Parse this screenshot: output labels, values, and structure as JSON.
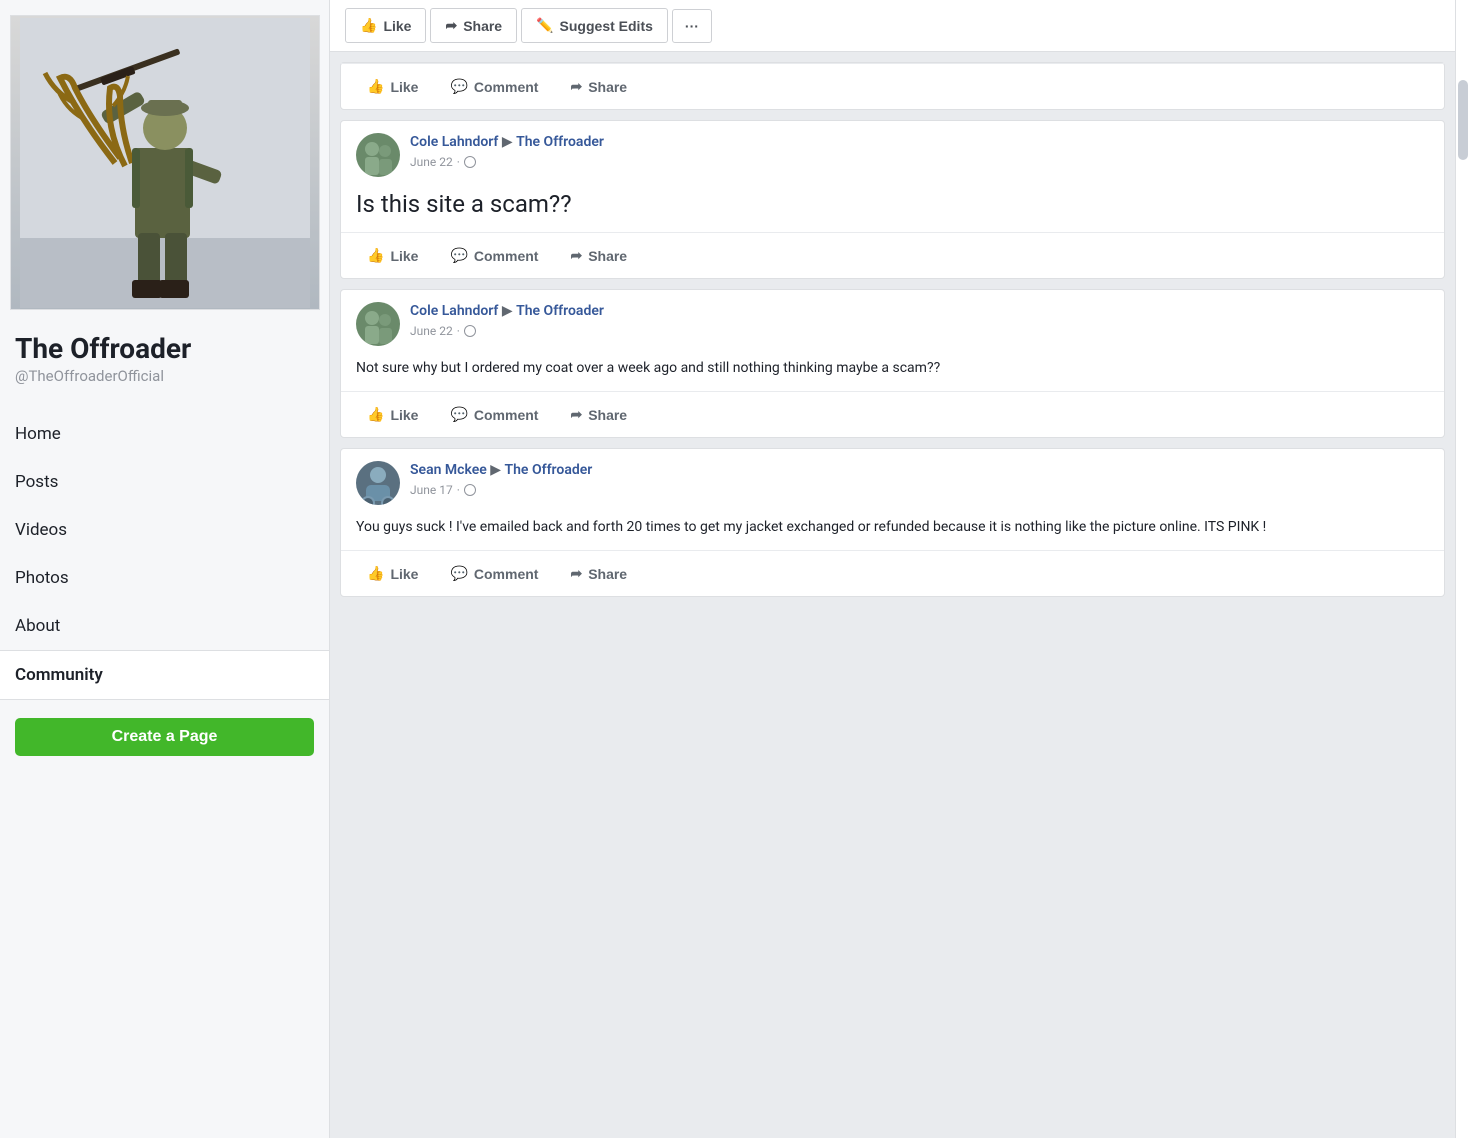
{
  "sidebar": {
    "page_name": "The Offroader",
    "page_handle": "@TheOffroaderOfficial",
    "nav_items": [
      {
        "label": "Home",
        "active": false
      },
      {
        "label": "Posts",
        "active": false
      },
      {
        "label": "Videos",
        "active": false
      },
      {
        "label": "Photos",
        "active": false
      },
      {
        "label": "About",
        "active": false
      },
      {
        "label": "Community",
        "active": true
      }
    ],
    "create_page_label": "Create a Page"
  },
  "action_bar": {
    "like_label": "Like",
    "share_label": "Share",
    "suggest_edits_label": "Suggest Edits",
    "more_label": "···"
  },
  "posts": [
    {
      "id": "post-top-action",
      "show_only_actions": true,
      "like_label": "Like",
      "comment_label": "Comment",
      "share_label": "Share"
    },
    {
      "id": "post-1",
      "author": "Cole Lahndorf",
      "arrow": "▶",
      "page": "The Offroader",
      "date": "June 22",
      "body": "Is this site a scam??",
      "large_text": true,
      "like_label": "Like",
      "comment_label": "Comment",
      "share_label": "Share"
    },
    {
      "id": "post-2",
      "author": "Cole Lahndorf",
      "arrow": "▶",
      "page": "The Offroader",
      "date": "June 22",
      "body": "Not sure why but I ordered my coat over a week ago and still nothing thinking maybe a scam??",
      "large_text": false,
      "like_label": "Like",
      "comment_label": "Comment",
      "share_label": "Share"
    },
    {
      "id": "post-3",
      "author": "Sean Mckee",
      "arrow": "▶",
      "page": "The Offroader",
      "date": "June 17",
      "body": "You guys suck ! I've emailed back and forth 20 times to get my jacket exchanged or refunded because it is nothing like the picture online. ITS PINK !",
      "large_text": false,
      "like_label": "Like",
      "comment_label": "Comment",
      "share_label": "Share"
    }
  ]
}
